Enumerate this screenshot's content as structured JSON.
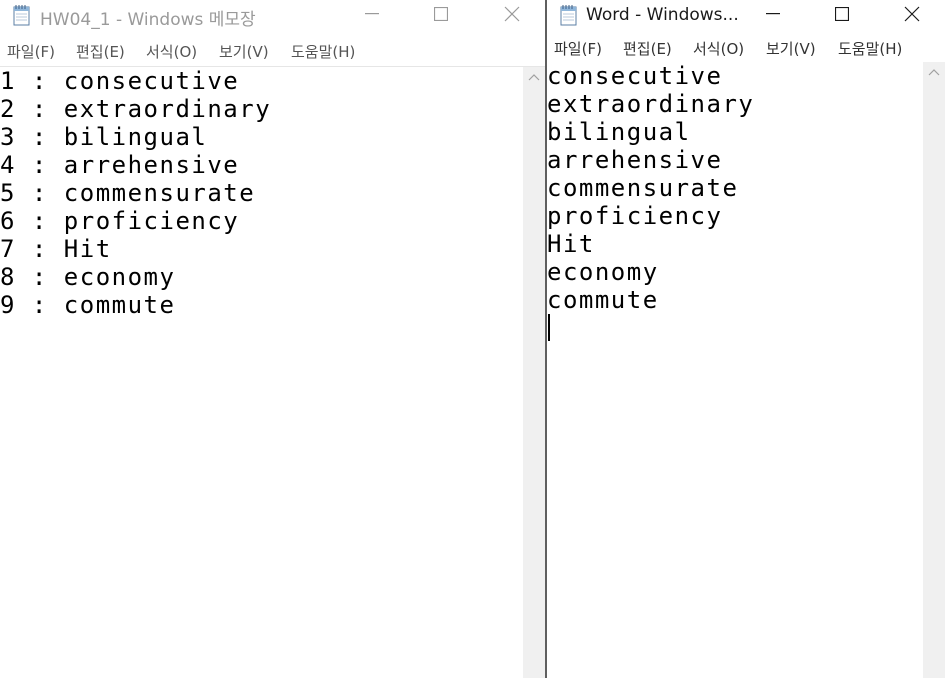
{
  "left_window": {
    "title": "HW04_1 - Windows 메모장",
    "menu": [
      "파일(F)",
      "편집(E)",
      "서식(O)",
      "보기(V)",
      "도움말(H)"
    ],
    "lines": [
      "1 : consecutive",
      "2 : extraordinary",
      "3 : bilingual",
      "4 : arrehensive",
      "5 : commensurate",
      "6 : proficiency",
      "7 : Hit",
      "8 : economy",
      "9 : commute"
    ]
  },
  "right_window": {
    "title": "Word - Windows...",
    "menu": [
      "파일(F)",
      "편집(E)",
      "서식(O)",
      "보기(V)",
      "도움말(H)"
    ],
    "lines": [
      "consecutive",
      "extraordinary",
      "bilingual",
      "arrehensive",
      "commensurate",
      "proficiency",
      "Hit",
      "economy",
      "commute"
    ]
  },
  "icons": {
    "app": "notepad-icon",
    "minimize": "minimize-icon",
    "maximize": "maximize-icon",
    "close": "close-icon",
    "scroll_up": "scroll-up-arrow-icon"
  },
  "colors": {
    "scrollbar_track": "#f0f0f0",
    "window_divider": "#5f5f5f",
    "inactive_title": "#9a9a9a"
  }
}
